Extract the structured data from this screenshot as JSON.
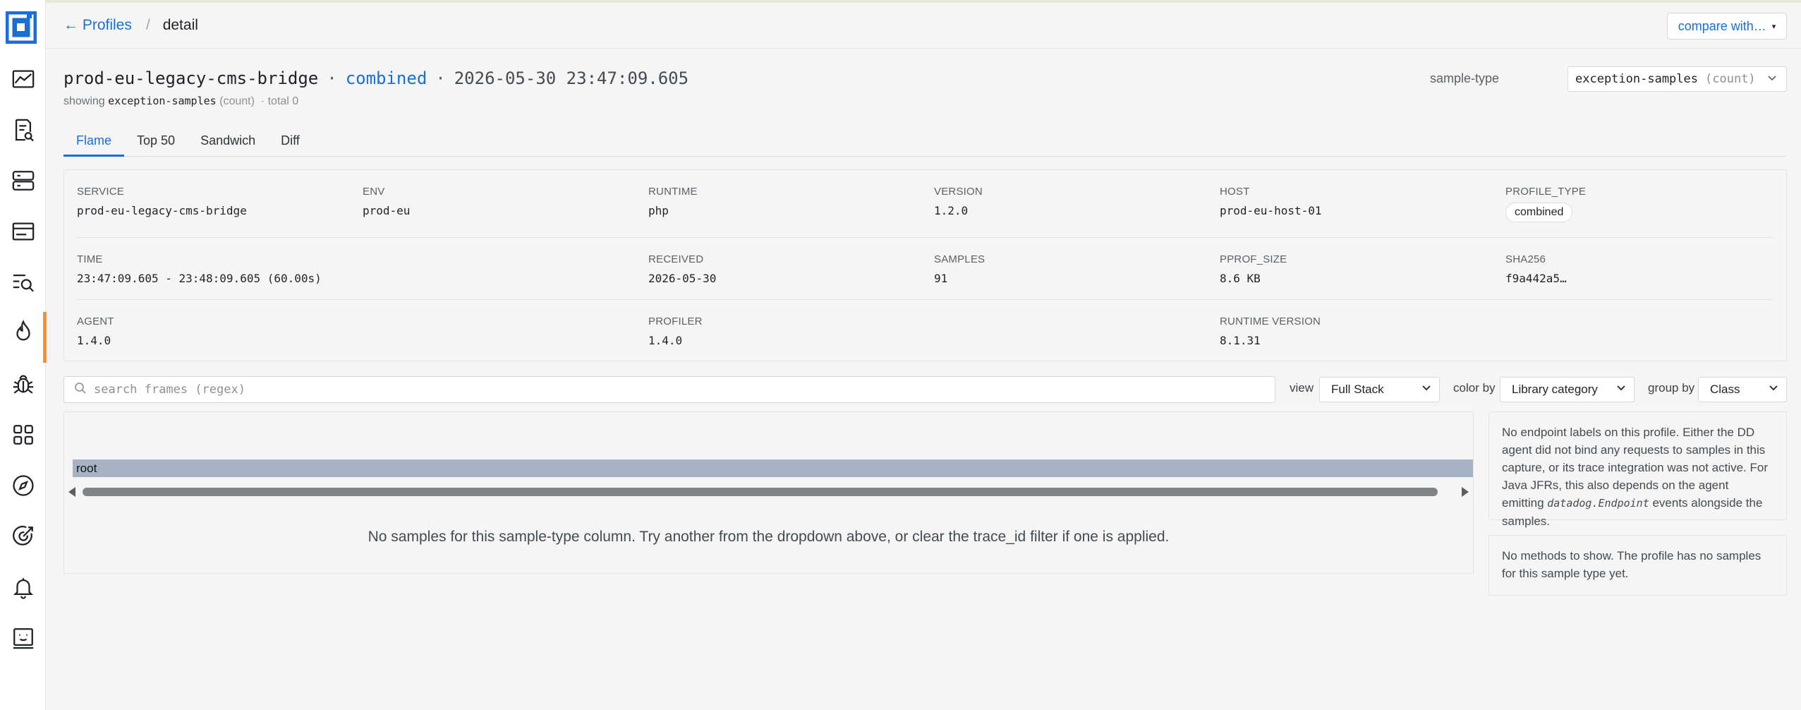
{
  "nav": {
    "logo": "app-logo",
    "items": [
      "metrics-icon",
      "log-search-icon",
      "servers-icon",
      "browser-icon",
      "query-icon",
      "flame-icon",
      "bug-icon",
      "grid-icon",
      "compass-icon",
      "target-icon",
      "bell-icon",
      "terminal-icon"
    ],
    "active_index": 5,
    "accent": "#f0913a"
  },
  "breadcrumb": {
    "back": "← Profiles",
    "separator": "/",
    "current": "detail"
  },
  "compare": {
    "label": "compare with…",
    "caret": "▾"
  },
  "header": {
    "service": "prod-eu-legacy-cms-bridge",
    "separator": "·",
    "kind": "combined",
    "timestamp": "2026-05-30 23:47:09.605"
  },
  "subline": {
    "showing": "showing",
    "sample_type": "exception-samples",
    "unit": "(count)",
    "total": "· total 0"
  },
  "sample_type_select": {
    "label": "sample-type",
    "value": "exception-samples",
    "unit": "(count)"
  },
  "tabs": [
    {
      "label": "Flame",
      "active": true
    },
    {
      "label": "Top 50",
      "active": false
    },
    {
      "label": "Sandwich",
      "active": false
    },
    {
      "label": "Diff",
      "active": false
    }
  ],
  "meta": {
    "service": {
      "k": "SERVICE",
      "v": "prod-eu-legacy-cms-bridge"
    },
    "env": {
      "k": "ENV",
      "v": "prod-eu"
    },
    "runtime": {
      "k": "RUNTIME",
      "v": "php"
    },
    "version": {
      "k": "VERSION",
      "v": "1.2.0"
    },
    "host": {
      "k": "HOST",
      "v": "prod-eu-host-01"
    },
    "profile_type": {
      "k": "PROFILE_TYPE",
      "v": "combined"
    },
    "time": {
      "k": "TIME",
      "v": "23:47:09.605 - 23:48:09.605 (60.00s)"
    },
    "received": {
      "k": "RECEIVED",
      "v": "2026-05-30"
    },
    "samples": {
      "k": "SAMPLES",
      "v": "91"
    },
    "pprof_size": {
      "k": "PPROF_SIZE",
      "v": "8.6 KB"
    },
    "sha256": {
      "k": "SHA256",
      "v": "f9a442a5…"
    },
    "agent": {
      "k": "AGENT",
      "v": "1.4.0"
    },
    "profiler": {
      "k": "PROFILER",
      "v": "1.4.0"
    },
    "runtime_version": {
      "k": "RUNTIME VERSION",
      "v": "8.1.31"
    }
  },
  "search": {
    "placeholder": "search frames (regex)"
  },
  "controls": {
    "view": {
      "label": "view",
      "value": "Full Stack"
    },
    "color_by": {
      "label": "color by",
      "value": "Library category"
    },
    "group_by": {
      "label": "group by",
      "value": "Class"
    }
  },
  "flame": {
    "root_label": "root",
    "empty_message": "No samples for this sample-type column. Try another from the dropdown above, or clear the trace_id filter if one is applied."
  },
  "endpoints_card": {
    "text_before": "No endpoint labels on this profile. Either the DD agent did not bind any requests to samples in this capture, or its trace integration was not active. For Java JFRs, this also depends on the agent emitting ",
    "code": "datadog.Endpoint",
    "text_after": " events alongside the samples."
  },
  "methods_card": {
    "text": "No methods to show. The profile has no samples for this sample type yet."
  },
  "colors": {
    "accent_blue": "#1a6fd6",
    "root_bar": "#a7b3c4"
  }
}
